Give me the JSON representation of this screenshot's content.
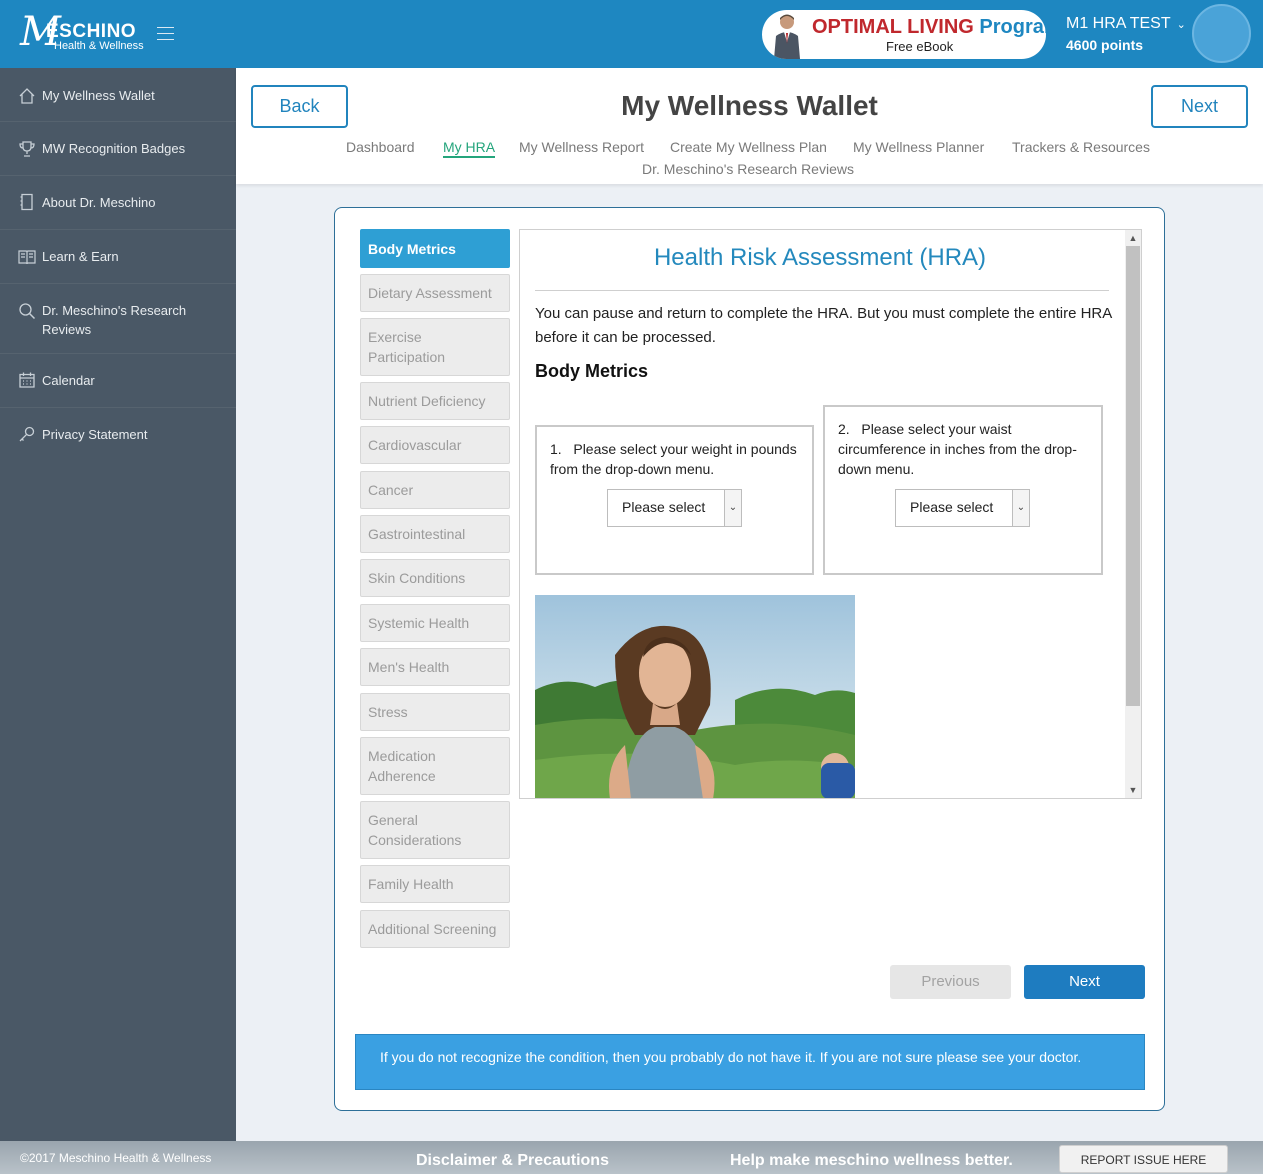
{
  "topbar": {
    "logo": {
      "mark": "M",
      "name": "ESCHINO",
      "tagline": "Health & Wellness"
    },
    "promo": {
      "title_main": "OPTIMAL LIVING",
      "title_accent": "Program",
      "subtitle": "Free eBook"
    },
    "user": {
      "name": "M1 HRA TEST",
      "points": "4600 points"
    },
    "colors": {
      "bar": "#1e87c1",
      "promo_red": "#c0282d"
    }
  },
  "sidebar": {
    "items": [
      {
        "label": "My Wellness Wallet",
        "icon": "home-icon"
      },
      {
        "label": "MW Recognition Badges",
        "icon": "trophy-icon"
      },
      {
        "label": "About Dr. Meschino",
        "icon": "notebook-icon"
      },
      {
        "label": "Learn & Earn",
        "icon": "book-icon"
      },
      {
        "label": "Dr. Meschino's Research Reviews",
        "icon": "search-icon"
      },
      {
        "label": "Calendar",
        "icon": "calendar-icon"
      },
      {
        "label": "Privacy Statement",
        "icon": "key-icon"
      }
    ]
  },
  "header": {
    "back_label": "Back",
    "title": "My Wellness Wallet",
    "next_label": "Next",
    "tabs": [
      "Dashboard",
      "My HRA",
      "My Wellness Report",
      "Create My Wellness Plan",
      "My Wellness Planner",
      "Trackers & Resources",
      "Dr. Meschino's Research Reviews"
    ],
    "active_tab": "My HRA"
  },
  "hra": {
    "nav": [
      "Body Metrics",
      "Dietary Assessment",
      "Exercise Participation",
      "Nutrient Deficiency",
      "Cardiovascular",
      "Cancer",
      "Gastrointestinal",
      "Skin Conditions",
      "Systemic Health",
      "Men's Health",
      "Stress",
      "Medication Adherence",
      "General Considerations",
      "Family Health",
      "Additional Screening"
    ],
    "active_nav": "Body Metrics",
    "title": "Health Risk Assessment (HRA)",
    "intro": "You can pause and return to complete the HRA. But you must complete the entire HRA before it can be processed.",
    "section_title": "Body Metrics",
    "questions": [
      {
        "number": "1.",
        "text": "Please select your weight in pounds from the drop-down menu.",
        "value": "Please select"
      },
      {
        "number": "2.",
        "text": "Please select your waist circumference in inches from the drop-down menu.",
        "value": "Please select"
      }
    ],
    "previous_label": "Previous",
    "next_label": "Next",
    "note": "If you do not recognize the condition, then you probably do not have it. If you are not sure please see your doctor."
  },
  "footer": {
    "copyright": "©2017 Meschino Health & Wellness",
    "disclaimer": "Disclaimer & Precautions",
    "help": "Help make meschino wellness better.",
    "report": "REPORT ISSUE HERE"
  }
}
